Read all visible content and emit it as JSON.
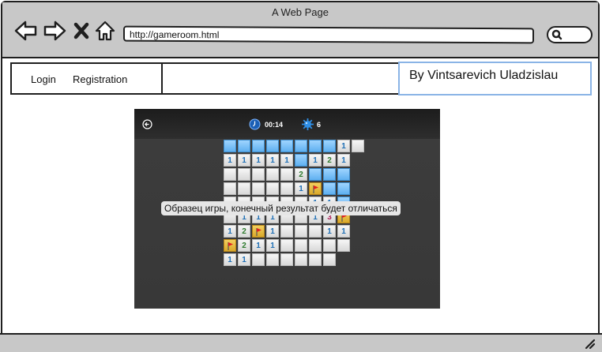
{
  "window": {
    "title": "A Web Page"
  },
  "browser": {
    "url": "http://gameroom.html",
    "icons": [
      "back-arrow-icon",
      "forward-arrow-icon",
      "close-icon",
      "home-icon",
      "search-icon"
    ]
  },
  "nav": {
    "login_label": "Login",
    "registration_label": "Registration"
  },
  "author": {
    "text": "By Vintsarevich Uladzislau"
  },
  "game": {
    "timer": "00:14",
    "mines_left": "6",
    "caption": "Образец игры, конечный результат будет отличаться",
    "grid_legend": "u = unopened, o = opened empty, f = flag, digit = number",
    "rows": [
      "uuuuuuuu1o",
      "11111u121",
      "ooooo2uuu",
      "ooooo1fuu",
      "oooooo11u",
      "o111oo13f",
      "12f1ooo11",
      "f211ooooo",
      "11oooooo"
    ]
  },
  "colors": {
    "chrome": "#c8c8c8",
    "author_border": "#8ab4e6",
    "game_bg": "#383838",
    "unopened": "#5fb0f0",
    "flag": "#d9a92a"
  }
}
